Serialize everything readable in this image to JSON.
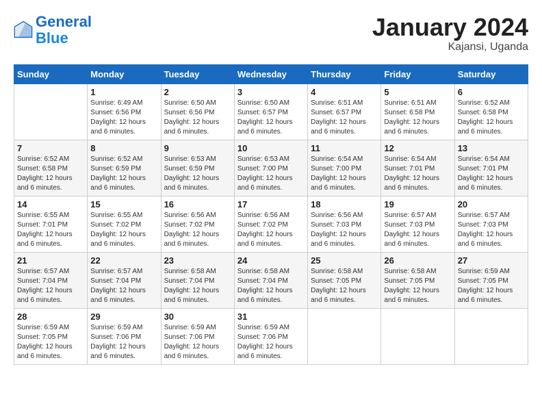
{
  "header": {
    "logo_line1": "General",
    "logo_line2": "Blue",
    "month": "January 2024",
    "location": "Kajansi, Uganda"
  },
  "weekdays": [
    "Sunday",
    "Monday",
    "Tuesday",
    "Wednesday",
    "Thursday",
    "Friday",
    "Saturday"
  ],
  "weeks": [
    [
      {
        "day": "",
        "info": ""
      },
      {
        "day": "1",
        "info": "Sunrise: 6:49 AM\nSunset: 6:56 PM\nDaylight: 12 hours\nand 6 minutes."
      },
      {
        "day": "2",
        "info": "Sunrise: 6:50 AM\nSunset: 6:56 PM\nDaylight: 12 hours\nand 6 minutes."
      },
      {
        "day": "3",
        "info": "Sunrise: 6:50 AM\nSunset: 6:57 PM\nDaylight: 12 hours\nand 6 minutes."
      },
      {
        "day": "4",
        "info": "Sunrise: 6:51 AM\nSunset: 6:57 PM\nDaylight: 12 hours\nand 6 minutes."
      },
      {
        "day": "5",
        "info": "Sunrise: 6:51 AM\nSunset: 6:58 PM\nDaylight: 12 hours\nand 6 minutes."
      },
      {
        "day": "6",
        "info": "Sunrise: 6:52 AM\nSunset: 6:58 PM\nDaylight: 12 hours\nand 6 minutes."
      }
    ],
    [
      {
        "day": "7",
        "info": "Sunrise: 6:52 AM\nSunset: 6:58 PM\nDaylight: 12 hours\nand 6 minutes."
      },
      {
        "day": "8",
        "info": "Sunrise: 6:52 AM\nSunset: 6:59 PM\nDaylight: 12 hours\nand 6 minutes."
      },
      {
        "day": "9",
        "info": "Sunrise: 6:53 AM\nSunset: 6:59 PM\nDaylight: 12 hours\nand 6 minutes."
      },
      {
        "day": "10",
        "info": "Sunrise: 6:53 AM\nSunset: 7:00 PM\nDaylight: 12 hours\nand 6 minutes."
      },
      {
        "day": "11",
        "info": "Sunrise: 6:54 AM\nSunset: 7:00 PM\nDaylight: 12 hours\nand 6 minutes."
      },
      {
        "day": "12",
        "info": "Sunrise: 6:54 AM\nSunset: 7:01 PM\nDaylight: 12 hours\nand 6 minutes."
      },
      {
        "day": "13",
        "info": "Sunrise: 6:54 AM\nSunset: 7:01 PM\nDaylight: 12 hours\nand 6 minutes."
      }
    ],
    [
      {
        "day": "14",
        "info": "Sunrise: 6:55 AM\nSunset: 7:01 PM\nDaylight: 12 hours\nand 6 minutes."
      },
      {
        "day": "15",
        "info": "Sunrise: 6:55 AM\nSunset: 7:02 PM\nDaylight: 12 hours\nand 6 minutes."
      },
      {
        "day": "16",
        "info": "Sunrise: 6:56 AM\nSunset: 7:02 PM\nDaylight: 12 hours\nand 6 minutes."
      },
      {
        "day": "17",
        "info": "Sunrise: 6:56 AM\nSunset: 7:02 PM\nDaylight: 12 hours\nand 6 minutes."
      },
      {
        "day": "18",
        "info": "Sunrise: 6:56 AM\nSunset: 7:03 PM\nDaylight: 12 hours\nand 6 minutes."
      },
      {
        "day": "19",
        "info": "Sunrise: 6:57 AM\nSunset: 7:03 PM\nDaylight: 12 hours\nand 6 minutes."
      },
      {
        "day": "20",
        "info": "Sunrise: 6:57 AM\nSunset: 7:03 PM\nDaylight: 12 hours\nand 6 minutes."
      }
    ],
    [
      {
        "day": "21",
        "info": "Sunrise: 6:57 AM\nSunset: 7:04 PM\nDaylight: 12 hours\nand 6 minutes."
      },
      {
        "day": "22",
        "info": "Sunrise: 6:57 AM\nSunset: 7:04 PM\nDaylight: 12 hours\nand 6 minutes."
      },
      {
        "day": "23",
        "info": "Sunrise: 6:58 AM\nSunset: 7:04 PM\nDaylight: 12 hours\nand 6 minutes."
      },
      {
        "day": "24",
        "info": "Sunrise: 6:58 AM\nSunset: 7:04 PM\nDaylight: 12 hours\nand 6 minutes."
      },
      {
        "day": "25",
        "info": "Sunrise: 6:58 AM\nSunset: 7:05 PM\nDaylight: 12 hours\nand 6 minutes."
      },
      {
        "day": "26",
        "info": "Sunrise: 6:58 AM\nSunset: 7:05 PM\nDaylight: 12 hours\nand 6 minutes."
      },
      {
        "day": "27",
        "info": "Sunrise: 6:59 AM\nSunset: 7:05 PM\nDaylight: 12 hours\nand 6 minutes."
      }
    ],
    [
      {
        "day": "28",
        "info": "Sunrise: 6:59 AM\nSunset: 7:05 PM\nDaylight: 12 hours\nand 6 minutes."
      },
      {
        "day": "29",
        "info": "Sunrise: 6:59 AM\nSunset: 7:06 PM\nDaylight: 12 hours\nand 6 minutes."
      },
      {
        "day": "30",
        "info": "Sunrise: 6:59 AM\nSunset: 7:06 PM\nDaylight: 12 hours\nand 6 minutes."
      },
      {
        "day": "31",
        "info": "Sunrise: 6:59 AM\nSunset: 7:06 PM\nDaylight: 12 hours\nand 6 minutes."
      },
      {
        "day": "",
        "info": ""
      },
      {
        "day": "",
        "info": ""
      },
      {
        "day": "",
        "info": ""
      }
    ]
  ]
}
